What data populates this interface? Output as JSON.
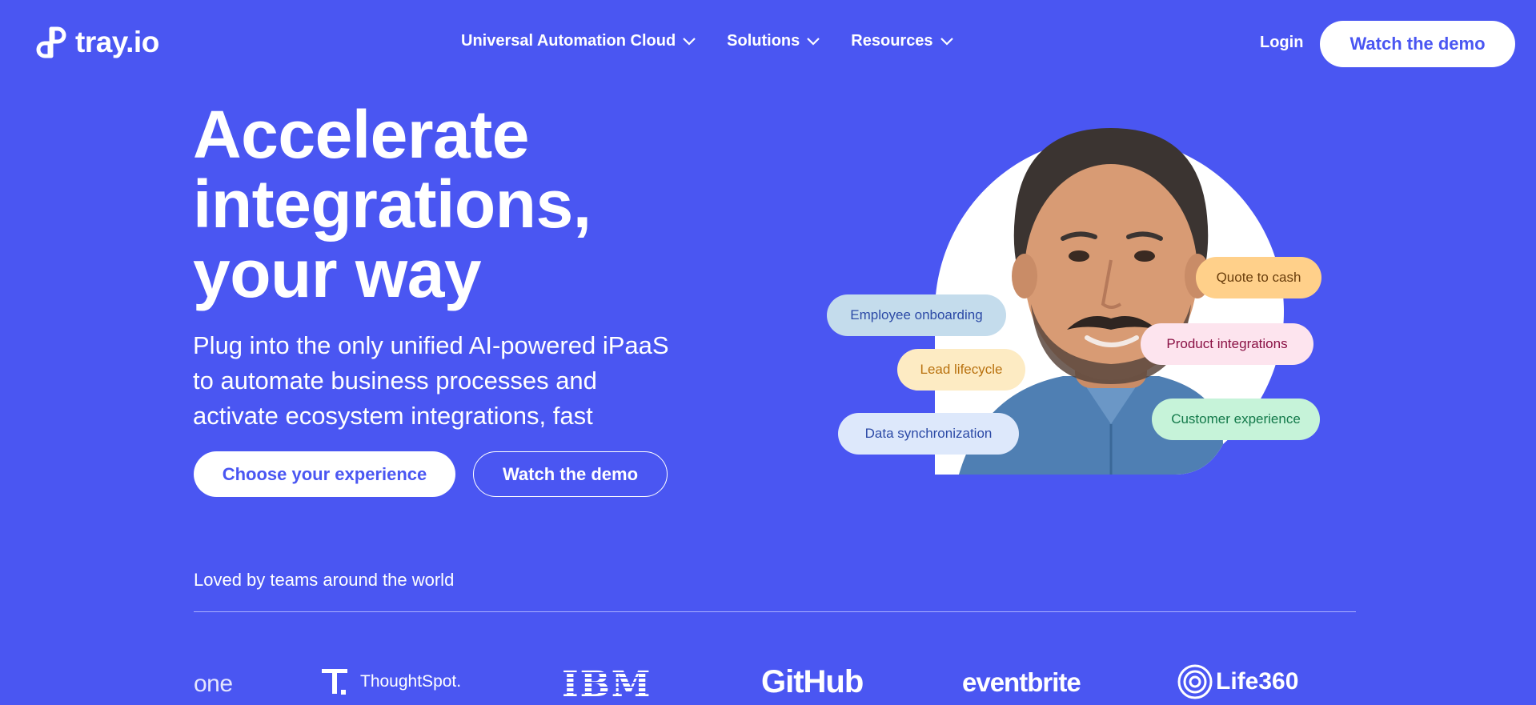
{
  "brand": {
    "name": "tray.io"
  },
  "nav": {
    "items": [
      {
        "label": "Universal Automation Cloud"
      },
      {
        "label": "Solutions"
      },
      {
        "label": "Resources"
      }
    ],
    "login": "Login",
    "cta": "Watch the demo"
  },
  "hero": {
    "title_lines": [
      "Accelerate",
      "integrations,",
      "your way"
    ],
    "subtitle_lines": [
      "Plug into the only unified AI-powered iPaaS",
      "to automate business processes and",
      "activate ecosystem integrations, fast"
    ],
    "primary_button": "Choose your experience",
    "secondary_button": "Watch the demo"
  },
  "pills": [
    {
      "label": "Employee onboarding"
    },
    {
      "label": "Lead lifecycle"
    },
    {
      "label": "Data synchronization"
    },
    {
      "label": "Quote to cash"
    },
    {
      "label": "Product integrations"
    },
    {
      "label": "Customer experience"
    }
  ],
  "social_proof": {
    "heading": "Loved by teams around the world",
    "logos": [
      "one",
      "ThoughtSpot.",
      "IBM",
      "GitHub",
      "eventbrite",
      "Life360"
    ]
  },
  "colors": {
    "background": "#4a56f2",
    "accent": "#4a56f2",
    "text": "#ffffff"
  }
}
